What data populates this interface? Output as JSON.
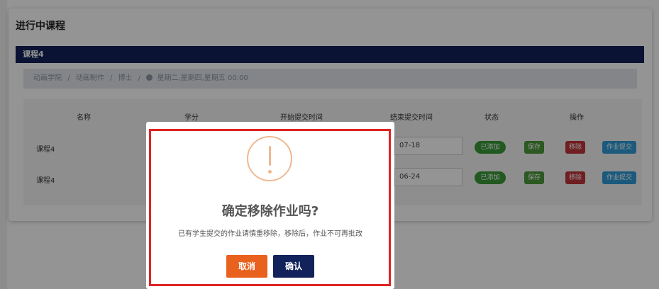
{
  "page": {
    "title": "进行中课程"
  },
  "course_bar": {
    "label": "课程4"
  },
  "breadcrumb": {
    "items": [
      "动画学院",
      "动画制作",
      "博士"
    ],
    "separator": "/",
    "schedule": "星期二,星期四,星期五 00:00"
  },
  "table": {
    "headers": [
      "名称",
      "学分",
      "开始提交时间",
      "结束提交时间",
      "状态",
      "操作"
    ],
    "rows": [
      {
        "name": "课程4",
        "end_date": "07-18",
        "status": "已添加",
        "save": "保存",
        "remove": "移除",
        "submit": "作业提交"
      },
      {
        "name": "课程4",
        "end_date": "06-24",
        "status": "已添加",
        "save": "保存",
        "remove": "移除",
        "submit": "作业提交"
      }
    ]
  },
  "dialog": {
    "icon": "warning-icon",
    "title": "确定移除作业吗?",
    "message": "已有学生提交的作业请慎重移除，移除后，作业不可再批改",
    "cancel_label": "取消",
    "confirm_label": "确认"
  },
  "colors": {
    "navy": "#12225a",
    "cancel": "#e8611d",
    "highlight": "#e02424",
    "warning": "#f0b890"
  }
}
